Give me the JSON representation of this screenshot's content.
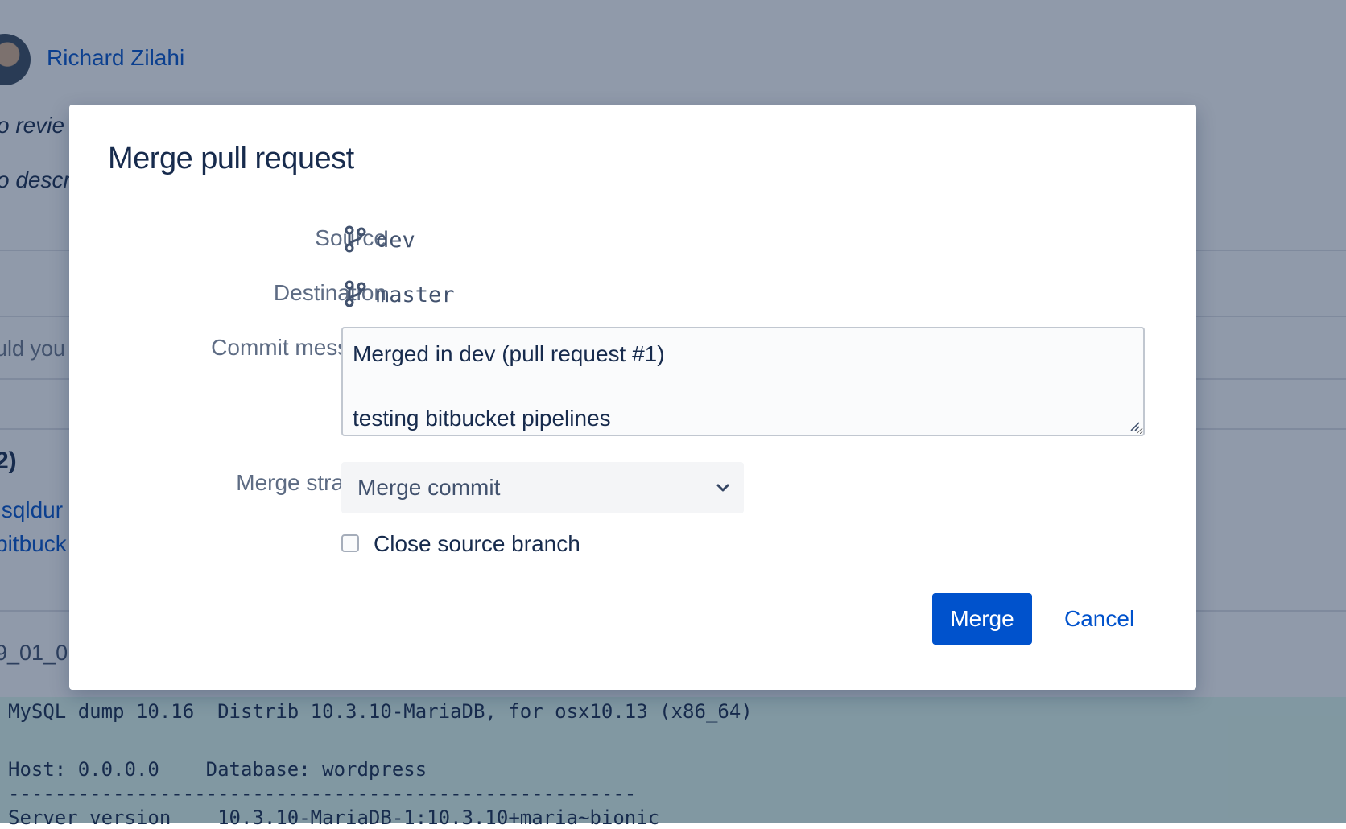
{
  "background": {
    "author_name": "Richard Zilahi",
    "fragment_review": "o revie",
    "fragment_description": "o descr",
    "fragment_question": "uld you",
    "fragment_count": "2)",
    "fragment_link_1": "!sqldur",
    "fragment_link_2": "bitbuck",
    "fragment_filename": "9_01_0",
    "code_lines": [
      "MySQL dump 10.16  Distrib 10.3.10-MariaDB, for osx10.13 (x86_64)",
      "",
      "Host: 0.0.0.0    Database: wordpress",
      "------------------------------------------------------",
      "Server version    10.3.10-MariaDB-1:10.3.10+maria~bionic"
    ]
  },
  "dialog": {
    "title": "Merge pull request",
    "source_label": "Source",
    "source_branch": "dev",
    "destination_label": "Destination",
    "destination_branch": "master",
    "commit_label": "Commit message",
    "commit_lines": [
      "Merged in dev (pull request #1)",
      "",
      "testing bitbucket pipelines"
    ],
    "strategy_label": "Merge strategy",
    "strategy_value": "Merge commit",
    "close_branch_label": "Close source branch",
    "close_branch_checked": false,
    "merge_button": "Merge",
    "cancel_button": "Cancel"
  },
  "colors": {
    "primary": "#0052cc",
    "overlay": "#172b4d",
    "label": "#5e6c84",
    "text": "#172b4d"
  },
  "icons": {
    "branch": "branch-icon",
    "dropdown": "chevron-down-icon"
  }
}
